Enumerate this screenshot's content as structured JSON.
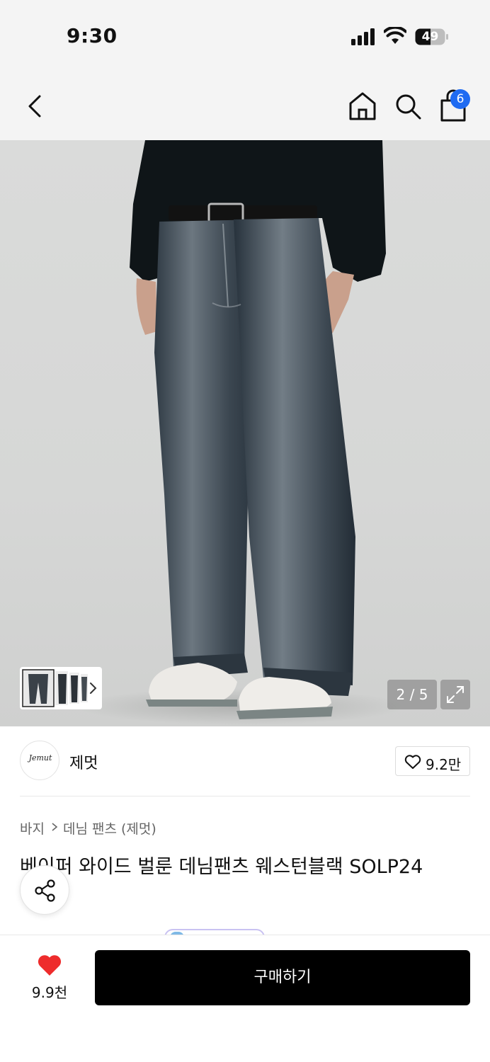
{
  "status_bar": {
    "time": "9:30",
    "battery_level": "49"
  },
  "nav": {
    "back_icon": "chevron-left-icon",
    "home_icon": "home-icon",
    "search_icon": "search-icon",
    "cart_icon": "shopping-bag-icon",
    "cart_badge": "6",
    "badge_color": "#1f6bf2"
  },
  "gallery": {
    "page_indicator": "2 / 5",
    "current_page": 2,
    "total_pages": 5,
    "expand_icon": "expand-icon",
    "thumbnail_arrow_icon": "chevron-right-icon"
  },
  "brand": {
    "logo_text": "Jemut",
    "name": "제멋",
    "like_count": "9.2만"
  },
  "breadcrumb": {
    "items": [
      "바지",
      "데님 팬츠 (제멋)"
    ]
  },
  "product": {
    "title": "베이퍼 와이드 벌룬 데님팬츠 웨스턴블랙 SOLP24"
  },
  "share_icon": "share-icon",
  "bottom_bar": {
    "wish_count": "9.9천",
    "wish_color": "#ee2c2c",
    "buy_label": "구매하기"
  }
}
